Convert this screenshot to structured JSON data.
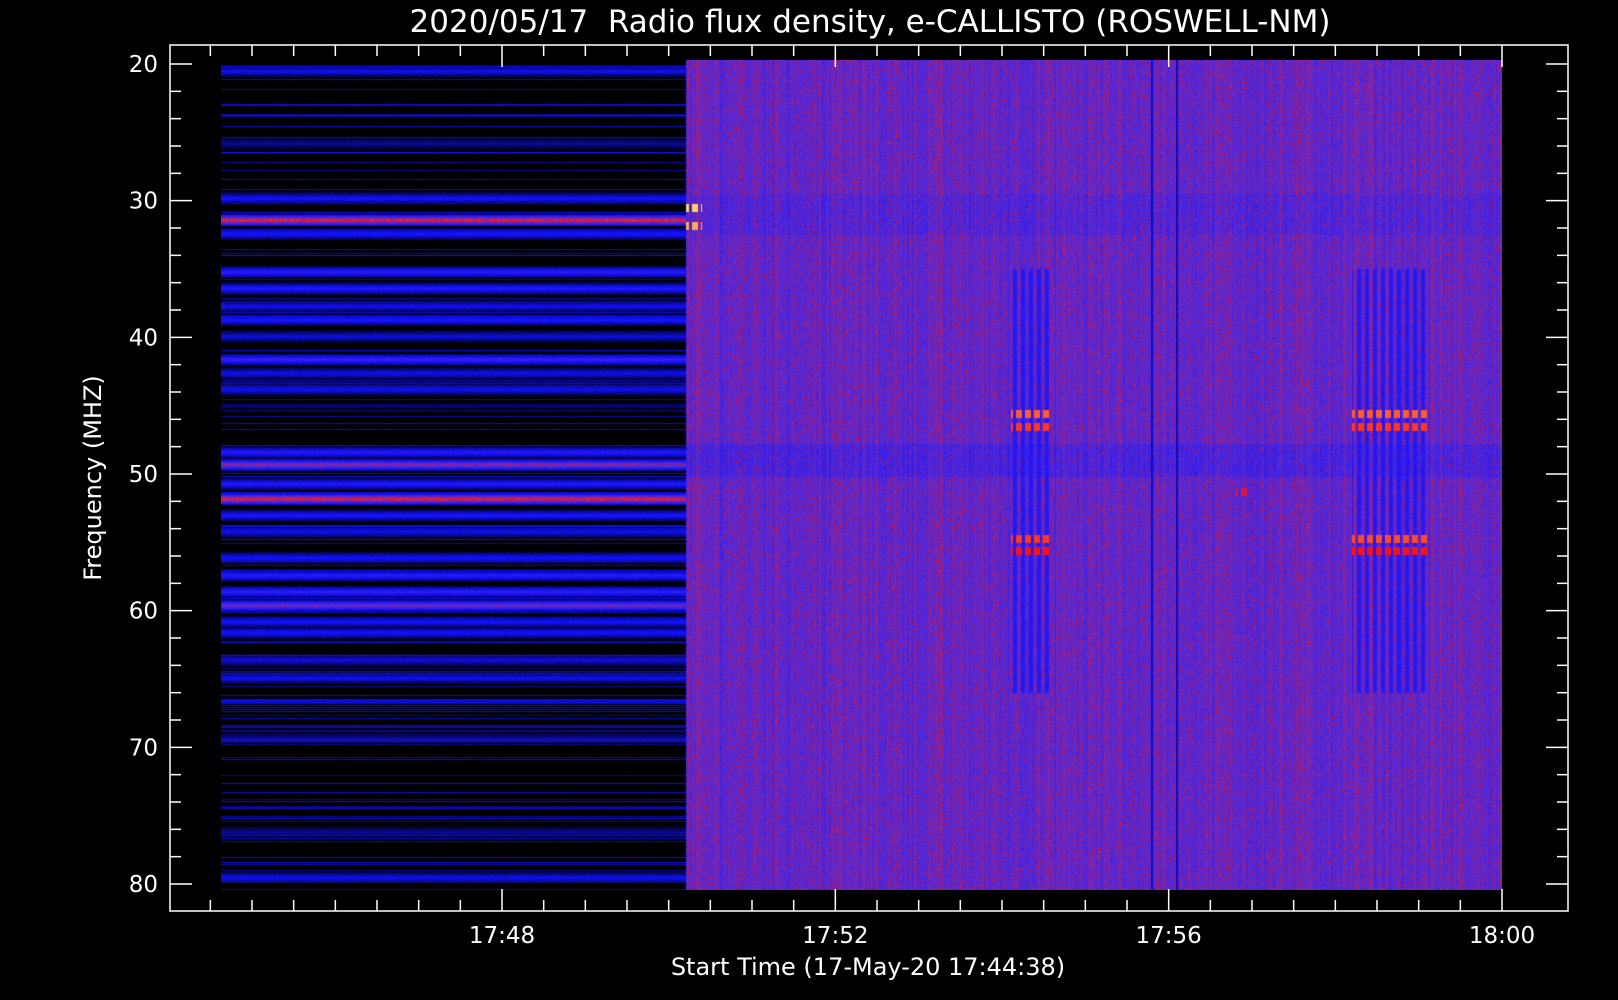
{
  "chart_data": {
    "type": "heatmap",
    "title": "2020/05/17  Radio flux density, e-CALLISTO (ROSWELL-NM)",
    "xlabel": "Start Time (17-May-20 17:44:38)",
    "ylabel": "Frequency (MHZ)",
    "x_range_minutes": [
      17.0,
      32.5
    ],
    "y_range_mhz": [
      20,
      80
    ],
    "y_inverted": true,
    "y_ticks": [
      20,
      30,
      40,
      50,
      60,
      70,
      80
    ],
    "x_ticks": [
      {
        "label": "17:48",
        "minute": 48
      },
      {
        "label": "17:52",
        "minute": 52
      },
      {
        "label": "17:56",
        "minute": 56
      },
      {
        "label": "18:00",
        "minute": 60
      }
    ],
    "data_start_minute": 44.63,
    "data_end_minute": 60.0,
    "instrument_onset_minute": 50.2,
    "colormap": [
      "#000000",
      "#1010ff",
      "#5a2ad0",
      "#ff1010",
      "#ffd060"
    ],
    "background_bands_mhz": [
      {
        "f": 20.5,
        "level": 1.0
      },
      {
        "f": 25.8,
        "level": 0.6
      },
      {
        "f": 29.8,
        "level": 1.1
      },
      {
        "f": 31.4,
        "level": 3.0
      },
      {
        "f": 32.4,
        "level": 1.2
      },
      {
        "f": 35.2,
        "level": 1.4
      },
      {
        "f": 36.4,
        "level": 1.3
      },
      {
        "f": 37.7,
        "level": 1.0
      },
      {
        "f": 38.7,
        "level": 1.2
      },
      {
        "f": 39.9,
        "level": 0.9
      },
      {
        "f": 41.6,
        "level": 1.6
      },
      {
        "f": 42.6,
        "level": 1.0
      },
      {
        "f": 43.8,
        "level": 1.0
      },
      {
        "f": 48.4,
        "level": 1.3
      },
      {
        "f": 49.3,
        "level": 2.4
      },
      {
        "f": 50.7,
        "level": 1.3
      },
      {
        "f": 51.8,
        "level": 3.0
      },
      {
        "f": 53.0,
        "level": 1.2
      },
      {
        "f": 54.2,
        "level": 1.0
      },
      {
        "f": 56.1,
        "level": 1.1
      },
      {
        "f": 57.4,
        "level": 1.4
      },
      {
        "f": 58.6,
        "level": 1.5
      },
      {
        "f": 59.6,
        "level": 2.2
      },
      {
        "f": 60.8,
        "level": 1.1
      },
      {
        "f": 61.6,
        "level": 1.1
      },
      {
        "f": 63.6,
        "level": 0.9
      },
      {
        "f": 64.9,
        "level": 1.0
      },
      {
        "f": 69.3,
        "level": 0.6
      },
      {
        "f": 76.2,
        "level": 0.6
      },
      {
        "f": 79.5,
        "level": 1.0
      }
    ],
    "bursts": [
      {
        "t0": 54.1,
        "t1": 54.6,
        "f": 45.6,
        "level": 3.4
      },
      {
        "t0": 54.1,
        "t1": 54.6,
        "f": 46.5,
        "level": 3.2
      },
      {
        "t0": 54.1,
        "t1": 54.6,
        "f": 54.7,
        "level": 3.2
      },
      {
        "t0": 54.1,
        "t1": 54.6,
        "f": 55.6,
        "level": 3.0
      },
      {
        "t0": 58.2,
        "t1": 59.1,
        "f": 45.6,
        "level": 3.4
      },
      {
        "t0": 58.2,
        "t1": 59.1,
        "f": 46.5,
        "level": 3.2
      },
      {
        "t0": 58.2,
        "t1": 59.1,
        "f": 54.7,
        "level": 3.3
      },
      {
        "t0": 58.2,
        "t1": 59.1,
        "f": 55.6,
        "level": 3.0
      },
      {
        "t0": 56.8,
        "t1": 56.95,
        "f": 51.3,
        "level": 2.8
      },
      {
        "t0": 50.2,
        "t1": 50.4,
        "f": 30.5,
        "level": 4.0
      },
      {
        "t0": 50.2,
        "t1": 50.4,
        "f": 31.8,
        "level": 3.8
      }
    ],
    "dark_columns_minute": [
      55.8,
      56.1
    ],
    "blue_regions": [
      {
        "t0": 54.1,
        "t1": 54.6,
        "f0": 35,
        "f1": 66
      },
      {
        "t0": 58.2,
        "t1": 59.1,
        "f0": 35,
        "f1": 66
      }
    ]
  }
}
